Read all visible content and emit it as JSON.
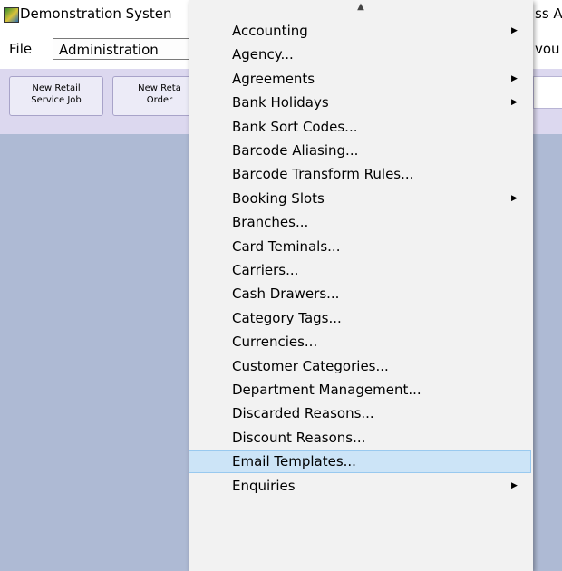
{
  "window": {
    "title": "Demonstration Systen",
    "title_right_fragment": "ss A"
  },
  "menubar": {
    "file_label": "File",
    "administration_label": "Administration",
    "right_fragment": "vou"
  },
  "toolbar": {
    "buttons": [
      {
        "line1": "New Retail",
        "line2": "Service Job"
      },
      {
        "line1": "New Reta",
        "line2": "Order"
      }
    ]
  },
  "dropdown": {
    "scroll_up_icon": "scroll-up-arrow-icon",
    "items": [
      {
        "label": "Accounting",
        "has_submenu": true,
        "arrow": "▶"
      },
      {
        "label": "Agency...",
        "has_submenu": false,
        "arrow": ""
      },
      {
        "label": "Agreements",
        "has_submenu": true,
        "arrow": "▶"
      },
      {
        "label": "Bank Holidays",
        "has_submenu": true,
        "arrow": "▶"
      },
      {
        "label": "Bank Sort Codes...",
        "has_submenu": false,
        "arrow": ""
      },
      {
        "label": "Barcode Aliasing...",
        "has_submenu": false,
        "arrow": ""
      },
      {
        "label": "Barcode Transform Rules...",
        "has_submenu": false,
        "arrow": ""
      },
      {
        "label": "Booking Slots",
        "has_submenu": true,
        "arrow": "▶"
      },
      {
        "label": "Branches...",
        "has_submenu": false,
        "arrow": ""
      },
      {
        "label": "Card Teminals...",
        "has_submenu": false,
        "arrow": ""
      },
      {
        "label": "Carriers...",
        "has_submenu": false,
        "arrow": ""
      },
      {
        "label": "Cash Drawers...",
        "has_submenu": false,
        "arrow": ""
      },
      {
        "label": "Category Tags...",
        "has_submenu": false,
        "arrow": ""
      },
      {
        "label": "Currencies...",
        "has_submenu": false,
        "arrow": ""
      },
      {
        "label": "Customer Categories...",
        "has_submenu": false,
        "arrow": ""
      },
      {
        "label": "Department Management...",
        "has_submenu": false,
        "arrow": ""
      },
      {
        "label": "Discarded Reasons...",
        "has_submenu": false,
        "arrow": ""
      },
      {
        "label": "Discount Reasons...",
        "has_submenu": false,
        "arrow": ""
      },
      {
        "label": "Email Templates...",
        "has_submenu": false,
        "arrow": "",
        "highlighted": true
      },
      {
        "label": "Enquiries",
        "has_submenu": true,
        "arrow": "▶"
      }
    ]
  },
  "colors": {
    "toolbar_bg": "#dcd8ef",
    "workspace_bg": "#aebad4",
    "menu_bg": "#f2f2f2",
    "highlight_bg": "#cce4f7",
    "highlight_border": "#99c9ef"
  }
}
